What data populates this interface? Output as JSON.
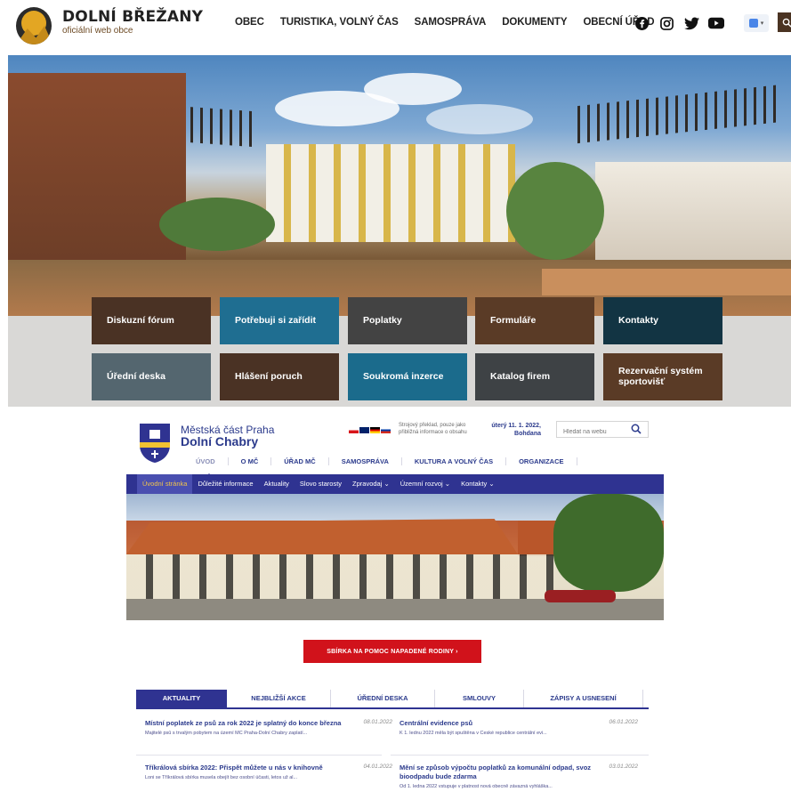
{
  "top_site": {
    "title": "DOLNÍ BŘEŽANY",
    "subtitle": "oficiální web obce",
    "nav": [
      "OBEC",
      "TURISTIKA, VOLNÝ ČAS",
      "SAMOSPRÁVA",
      "DOKUMENTY",
      "OBECNÍ ÚŘAD"
    ],
    "social_icons": [
      "facebook-icon",
      "instagram-icon",
      "twitter-icon",
      "youtube-icon"
    ],
    "translate_icon": "google-translate-icon",
    "search_icon": "search-icon",
    "tiles": [
      {
        "label": "Diskuzní fórum",
        "color": "#4a3224"
      },
      {
        "label": "Potřebuji si zařídit",
        "color": "#1f6e91"
      },
      {
        "label": "Poplatky",
        "color": "#434343"
      },
      {
        "label": "Formuláře",
        "color": "#5a3b26"
      },
      {
        "label": "Kontakty",
        "color": "#123443"
      },
      {
        "label": "Úřední deska",
        "color": "#54666f"
      },
      {
        "label": "Hlášení poruch",
        "color": "#4a3224"
      },
      {
        "label": "Soukromá inzerce",
        "color": "#1b6b8c"
      },
      {
        "label": "Katalog firem",
        "color": "#3e4245"
      },
      {
        "label": "Rezervační systém sportovišť",
        "color": "#5a3b26"
      }
    ]
  },
  "second_site": {
    "city": "Městská část Praha",
    "name": "Dolní Chabry",
    "translate_note": "Strojový překlad, pouze jako přibližná informace o obsahu",
    "date": "úterý 11. 1. 2022,",
    "nameday": "Bohdana",
    "search_placeholder": "Hledat na webu",
    "main_nav": [
      "ÚVOD",
      "O MČ",
      "ÚŘAD MČ",
      "SAMOSPRÁVA",
      "KULTURA A VOLNÝ ČAS",
      "ORGANIZACE"
    ],
    "sub_nav": [
      "Úvodní stránka",
      "Důležité informace",
      "Aktuality",
      "Slovo starosty",
      "Zpravodaj ⌄",
      "Územní rozvoj ⌄",
      "Kontakty ⌄"
    ],
    "cta": "SBÍRKA NA POMOC NAPADENÉ RODINY   ›",
    "tabs": [
      "AKTUALITY",
      "NEJBLIŽŠÍ AKCE",
      "ÚŘEDNÍ DESKA",
      "SMLOUVY",
      "ZÁPISY A USNESENÍ"
    ],
    "news": [
      {
        "title": "Místní poplatek ze psů za rok 2022 je splatný do konce března",
        "date": "08.01.2022",
        "excerpt": "Majitelé psů s trvalým pobytem na území MČ Praha-Dolní Chabry zaplatí..."
      },
      {
        "title": "Centrální evidence psů",
        "date": "06.01.2022",
        "excerpt": "K 1. lednu 2022 měla být spuštěna v České republice centrální evi..."
      },
      {
        "title": "Tříkrálová sbírka 2022: Přispět můžete u nás v knihovně",
        "date": "04.01.2022",
        "excerpt": "Loni se Tříkrálová sbírka musela obejít bez osobní účasti, letos už al..."
      },
      {
        "title": "Mění se způsob výpočtu poplatků za komunální odpad, svoz bioodpadu bude zdarma",
        "date": "03.01.2022",
        "excerpt": "Od 1. ledna 2022 vstupuje v platnost nová obecně závazná vyhláška..."
      }
    ]
  }
}
